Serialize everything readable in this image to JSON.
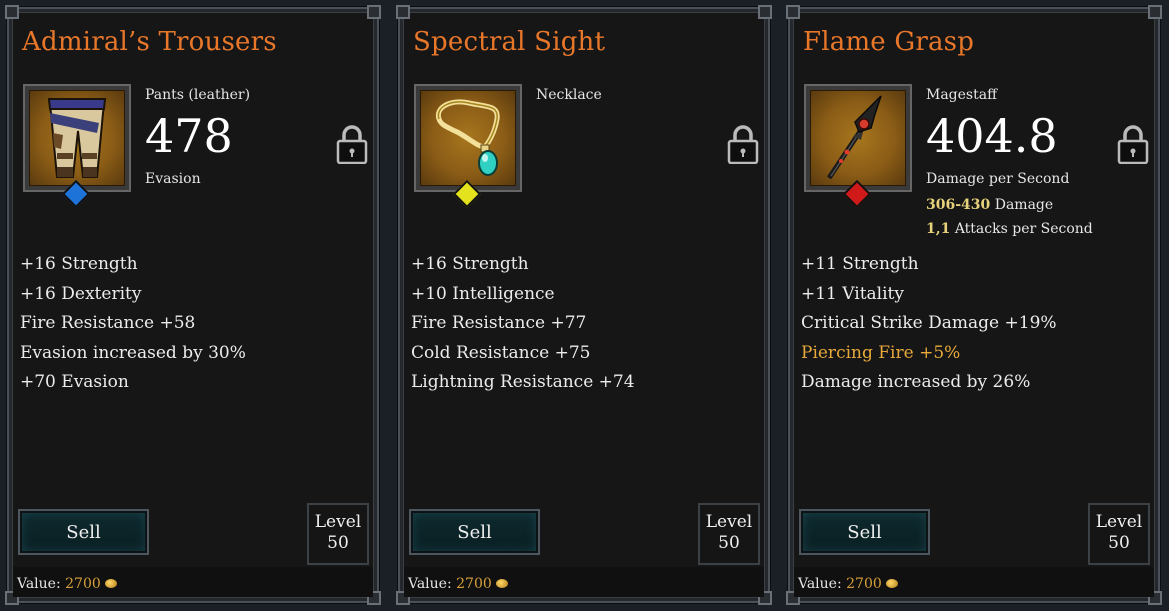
{
  "colors": {
    "title": "#e8772a",
    "highlight": "#e8a93a",
    "value": "#d7a03a",
    "gem_blue": "#1e73d8",
    "gem_yellow": "#e3e21c",
    "gem_red": "#d01a1a"
  },
  "cards": [
    {
      "title": "Admiral’s Trousers",
      "item_type": "Pants (leather)",
      "main_value": "478",
      "main_label": "Evasion",
      "icon": "leather-pants-icon",
      "properties": [
        "+16 Strength",
        "+16 Dexterity",
        "Fire Resistance +58",
        "Evasion increased by 30%",
        "+70 Evasion"
      ],
      "sell_label": "Sell",
      "level_label": "Level",
      "level_value": "50",
      "value_label": "Value:",
      "value_amount": "2700"
    },
    {
      "title": "Spectral Sight",
      "item_type": "Necklace",
      "main_value": "",
      "main_label": "",
      "icon": "necklace-icon",
      "properties": [
        "+16 Strength",
        "+10 Intelligence",
        "Fire Resistance +77",
        "Cold Resistance +75",
        "Lightning Resistance +74"
      ],
      "sell_label": "Sell",
      "level_label": "Level",
      "level_value": "50",
      "value_label": "Value:",
      "value_amount": "2700"
    },
    {
      "title": "Flame Grasp",
      "item_type": "Magestaff",
      "main_value": "404.8",
      "main_label": "Damage per Second",
      "damage_range": "306-430",
      "damage_label": "Damage",
      "attack_speed": "1,1",
      "attack_speed_label": "Attacks per Second",
      "icon": "magestaff-icon",
      "properties": [
        "+11 Strength",
        "+11 Vitality",
        "Critical Strike Damage +19%",
        "Piercing Fire +5%",
        "Damage increased by 26%"
      ],
      "sell_label": "Sell",
      "level_label": "Level",
      "level_value": "50",
      "value_label": "Value:",
      "value_amount": "2700"
    }
  ]
}
